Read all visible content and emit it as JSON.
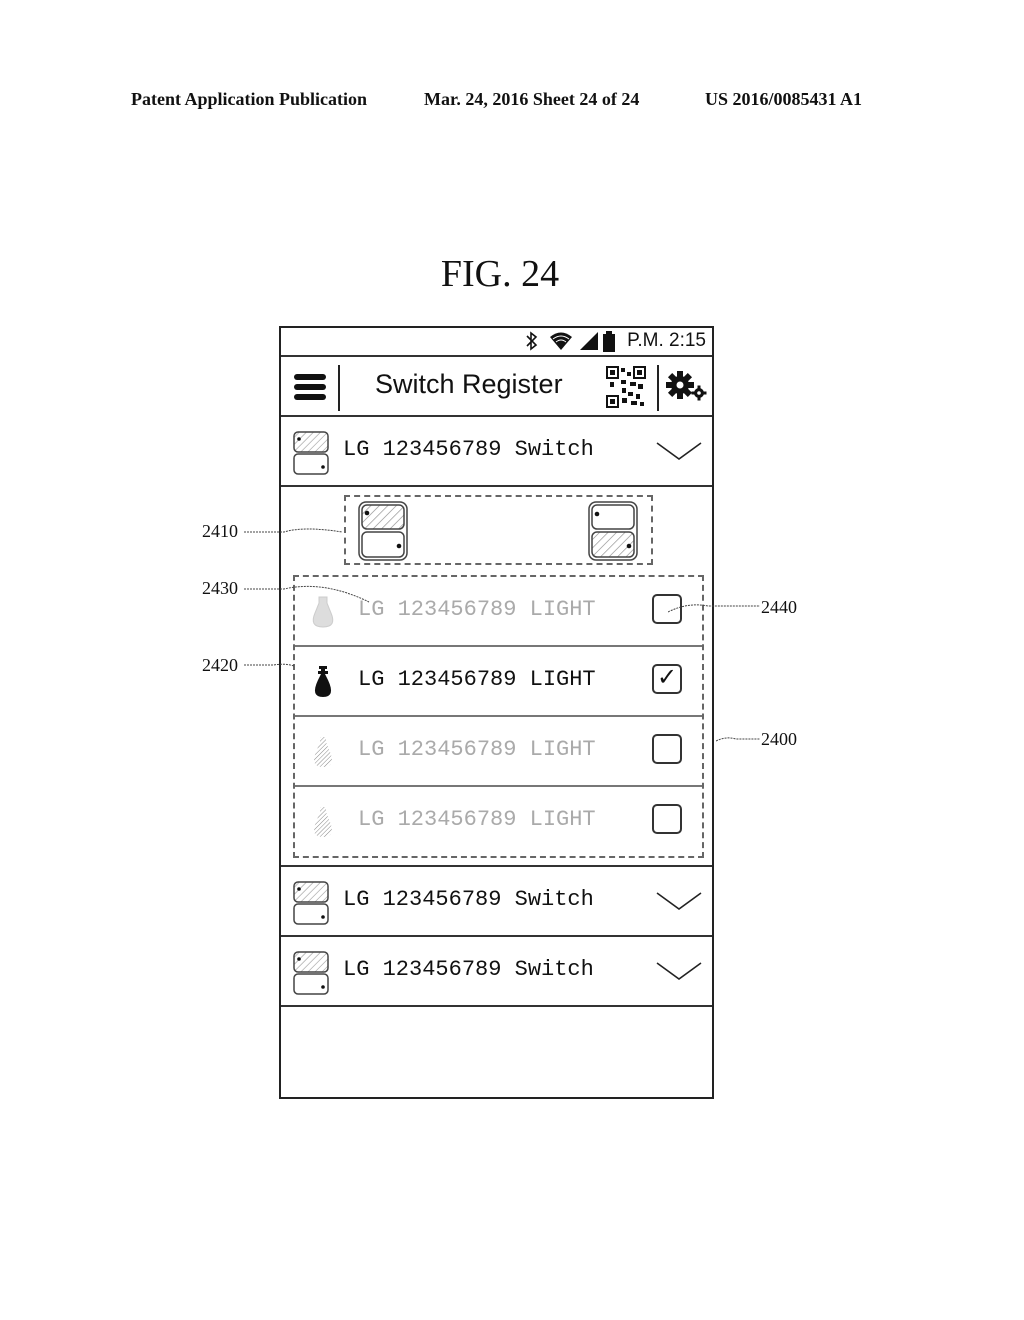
{
  "patent_header": {
    "left": "Patent Application Publication",
    "middle": "Mar. 24, 2016  Sheet 24 of 24",
    "right": "US 2016/0085431 A1"
  },
  "figure_title": "FIG. 24",
  "phone": {
    "status_bar": {
      "icons": [
        "bluetooth-icon",
        "wifi-icon",
        "signal-icon",
        "battery-icon"
      ],
      "time": "P.M. 2:15"
    },
    "app_bar": {
      "menu_icon": "hamburger-menu-icon",
      "title": "Switch Register",
      "qr_icon": "qr-code-icon",
      "settings_icon": "gear-icon"
    },
    "switches": [
      {
        "label": "LG 123456789 Switch",
        "expanded": true
      },
      {
        "label": "LG 123456789 Switch",
        "expanded": false
      },
      {
        "label": "LG 123456789 Switch",
        "expanded": false
      }
    ],
    "lights": [
      {
        "label": "LG 123456789 LIGHT",
        "checked": false,
        "active": false
      },
      {
        "label": "LG 123456789 LIGHT",
        "checked": true,
        "active": true
      },
      {
        "label": "LG 123456789 LIGHT",
        "checked": false,
        "active": false
      },
      {
        "label": "LG 123456789 LIGHT",
        "checked": false,
        "active": false
      }
    ],
    "checkmark": "✓"
  },
  "reference_numerals": {
    "r2400": "2400",
    "r2410": "2410",
    "r2420": "2420",
    "r2430": "2430",
    "r2440": "2440"
  }
}
